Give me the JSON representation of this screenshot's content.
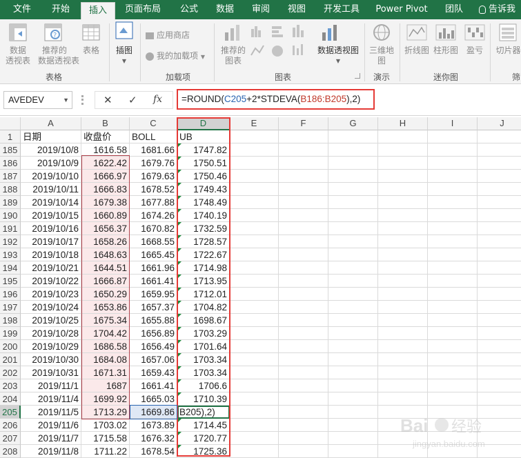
{
  "ribbon_tabs": [
    {
      "label": "文件"
    },
    {
      "label": "开始"
    },
    {
      "label": "插入",
      "active": true
    },
    {
      "label": "页面布局"
    },
    {
      "label": "公式"
    },
    {
      "label": "数据"
    },
    {
      "label": "审阅"
    },
    {
      "label": "视图"
    },
    {
      "label": "开发工具"
    },
    {
      "label": "Power Pivot"
    },
    {
      "label": "团队"
    },
    {
      "label": "告诉我"
    }
  ],
  "ribbon": {
    "tables": {
      "pivot_line1": "数据",
      "pivot_line2": "透视表",
      "recommended_line1": "推荐的",
      "recommended_line2": "数据透视表",
      "table": "表格",
      "group": "表格"
    },
    "illustrations": {
      "label": "插图"
    },
    "addins": {
      "store": "应用商店",
      "my_addins": "我的加载项",
      "group": "加载项"
    },
    "charts": {
      "recommended_line1": "推荐的",
      "recommended_line2": "图表",
      "pivot_chart": "数据透视图",
      "group": "图表"
    },
    "tours": {
      "map3d": "三维地",
      "map3d_line2": "图",
      "group": "演示"
    },
    "sparklines": {
      "line": "折线图",
      "column": "柱形图",
      "winloss": "盈亏",
      "group": "迷你图"
    },
    "filters": {
      "slicer": "切片器",
      "group": "筛"
    }
  },
  "formula_bar": {
    "name_box": "AVEDEV",
    "cancel_glyph": "✕",
    "enter_glyph": "✓",
    "fx_glyph": "fx",
    "formula_prefix": "=ROUND(",
    "ref1": "C205",
    "formula_mid": "+2*STDEVA(",
    "ref2": "B186:B205",
    "formula_suffix": "),2)"
  },
  "columns": [
    "A",
    "B",
    "C",
    "D",
    "E",
    "F",
    "G",
    "H",
    "I",
    "J"
  ],
  "header_row": {
    "row": "1",
    "A": "日期",
    "B": "收盘价",
    "C": "BOLL",
    "D": "UB"
  },
  "rows": [
    {
      "row": "185",
      "A": "2019/10/8",
      "B": "1616.58",
      "C": "1681.66",
      "D": "1747.82"
    },
    {
      "row": "186",
      "A": "2019/10/9",
      "B": "1622.42",
      "C": "1679.76",
      "D": "1750.51"
    },
    {
      "row": "187",
      "A": "2019/10/10",
      "B": "1666.97",
      "C": "1679.63",
      "D": "1750.46"
    },
    {
      "row": "188",
      "A": "2019/10/11",
      "B": "1666.83",
      "C": "1678.52",
      "D": "1749.43"
    },
    {
      "row": "189",
      "A": "2019/10/14",
      "B": "1679.38",
      "C": "1677.88",
      "D": "1748.49"
    },
    {
      "row": "190",
      "A": "2019/10/15",
      "B": "1660.89",
      "C": "1674.26",
      "D": "1740.19"
    },
    {
      "row": "191",
      "A": "2019/10/16",
      "B": "1656.37",
      "C": "1670.82",
      "D": "1732.59"
    },
    {
      "row": "192",
      "A": "2019/10/17",
      "B": "1658.26",
      "C": "1668.55",
      "D": "1728.57"
    },
    {
      "row": "193",
      "A": "2019/10/18",
      "B": "1648.63",
      "C": "1665.45",
      "D": "1722.67"
    },
    {
      "row": "194",
      "A": "2019/10/21",
      "B": "1644.51",
      "C": "1661.96",
      "D": "1714.98"
    },
    {
      "row": "195",
      "A": "2019/10/22",
      "B": "1666.87",
      "C": "1661.41",
      "D": "1713.95"
    },
    {
      "row": "196",
      "A": "2019/10/23",
      "B": "1650.29",
      "C": "1659.95",
      "D": "1712.01"
    },
    {
      "row": "197",
      "A": "2019/10/24",
      "B": "1653.86",
      "C": "1657.37",
      "D": "1704.82"
    },
    {
      "row": "198",
      "A": "2019/10/25",
      "B": "1675.34",
      "C": "1655.88",
      "D": "1698.67"
    },
    {
      "row": "199",
      "A": "2019/10/28",
      "B": "1704.42",
      "C": "1656.89",
      "D": "1703.29"
    },
    {
      "row": "200",
      "A": "2019/10/29",
      "B": "1686.58",
      "C": "1656.49",
      "D": "1701.64"
    },
    {
      "row": "201",
      "A": "2019/10/30",
      "B": "1684.08",
      "C": "1657.06",
      "D": "1703.34"
    },
    {
      "row": "202",
      "A": "2019/10/31",
      "B": "1671.31",
      "C": "1659.43",
      "D": "1703.34"
    },
    {
      "row": "203",
      "A": "2019/11/1",
      "B": "1687",
      "C": "1661.41",
      "D": "1706.6"
    },
    {
      "row": "204",
      "A": "2019/11/4",
      "B": "1699.92",
      "C": "1665.03",
      "D": "1710.39"
    },
    {
      "row": "205",
      "A": "2019/11/5",
      "B": "1713.29",
      "C": "1669.86",
      "D": "B205),2)"
    },
    {
      "row": "206",
      "A": "2019/11/6",
      "B": "1703.02",
      "C": "1673.89",
      "D": "1714.45"
    },
    {
      "row": "207",
      "A": "2019/11/7",
      "B": "1715.58",
      "C": "1676.32",
      "D": "1720.77"
    },
    {
      "row": "208",
      "A": "2019/11/8",
      "B": "1711.22",
      "C": "1678.54",
      "D": "1725.36"
    }
  ],
  "colors": {
    "excel_green": "#217346",
    "highlight_red": "#e53935",
    "ref_blue": "#2a64b0",
    "ref_red": "#c0392b",
    "range_shade": "#fbe9ea"
  }
}
